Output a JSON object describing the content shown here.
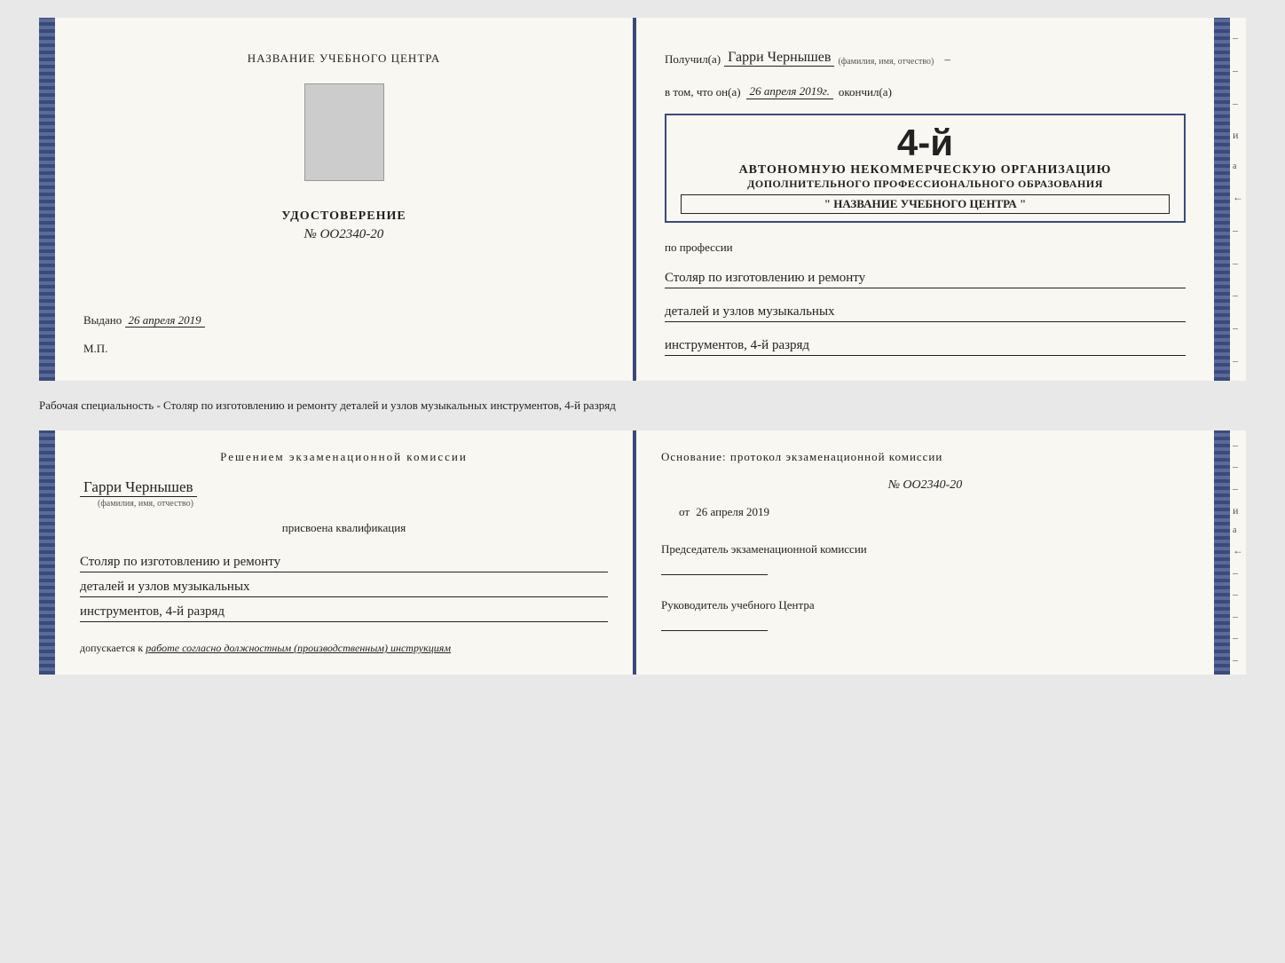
{
  "doc1": {
    "left": {
      "heading": "НАЗВАНИЕ УЧЕБНОГО ЦЕНТРА",
      "photo_alt": "фото",
      "udost_title": "УДОСТОВЕРЕНИЕ",
      "udost_num": "№ OO2340-20",
      "vydano_label": "Выдано",
      "vydano_value": "26 апреля 2019",
      "mp_label": "М.П."
    },
    "right": {
      "poluchil_label": "Получил(а)",
      "poluchil_name": "Гарри Чернышев",
      "fio_label": "(фамилия, имя, отчество)",
      "vtom_label": "в том, что он(а)",
      "vtom_date": "26 апреля 2019г.",
      "okonchil_label": "окончил(а)",
      "four_badge": "4-й",
      "stamp_line1": "АВТОНОМНУЮ НЕКОММЕРЧЕСКУЮ ОРГАНИЗАЦИЮ",
      "stamp_line2": "ДОПОЛНИТЕЛЬНОГО ПРОФЕССИОНАЛЬНОГО ОБРАЗОВАНИЯ",
      "stamp_line3": "\" НАЗВАНИЕ УЧЕБНОГО ЦЕНТРА \"",
      "po_professii_label": "по профессии",
      "profession_line1": "Столяр по изготовлению и ремонту",
      "profession_line2": "деталей и узлов музыкальных",
      "profession_line3": "инструментов, 4-й разряд"
    }
  },
  "caption": {
    "text": "Рабочая специальность - Столяр по изготовлению и ремонту деталей и узлов музыкальных инструментов, 4-й разряд"
  },
  "doc2": {
    "left": {
      "resheniem_title": "Решением  экзаменационной  комиссии",
      "name": "Гарри Чернышев",
      "fio_label": "(фамилия, имя, отчество)",
      "prisvoena_label": "присвоена квалификация",
      "kvalif_line1": "Столяр по изготовлению и ремонту",
      "kvalif_line2": "деталей и узлов музыкальных",
      "kvalif_line3": "инструментов, 4-й разряд",
      "dopuskaetsya_prefix": "допускается к",
      "dopuskaetsya_value": "работе согласно должностным (производственным) инструкциям"
    },
    "right": {
      "osnovanie_label": "Основание: протокол экзаменационной  комиссии",
      "num_label": "№  OO2340-20",
      "ot_label": "от",
      "ot_date": "26 апреля 2019",
      "predsedatel_label": "Председатель экзаменационной комиссии",
      "rukovoditel_label": "Руководитель учебного Центра"
    }
  },
  "spine_dashes": [
    "–",
    "–",
    "–",
    "и",
    "а",
    "←",
    "–",
    "–",
    "–",
    "–",
    "–"
  ],
  "spine_dashes2": [
    "–",
    "–",
    "–",
    "и",
    "а",
    "←",
    "–",
    "–",
    "–",
    "–",
    "–"
  ]
}
